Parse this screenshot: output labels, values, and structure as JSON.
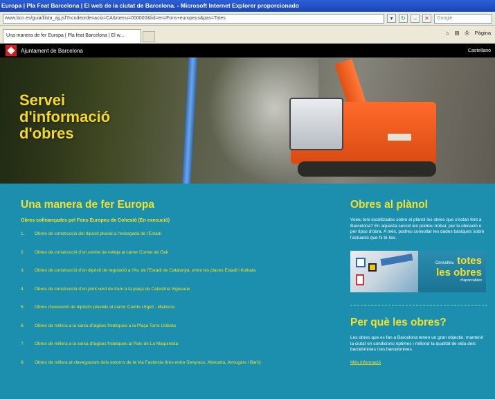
{
  "browser": {
    "title": "Europa | Pla Feat Barcelona | El web de la ciutat de Barcelona. - Microsoft Internet Explorer proporcionado",
    "address": "www.bcn.es/guia/llista_ajj.jsf?ncodeordenacio=CA&menu=000000&lid=en=Fons+europeus&pas=Totes",
    "search_placeholder": "Google",
    "tab_label": "Una manera de fer Europa | Pla feat Barcelona | El w...",
    "tools_page": "Pàgina"
  },
  "site": {
    "name": "Ajuntament de Barcelona",
    "language": "Castellano"
  },
  "hero": {
    "title_line1": "Servei",
    "title_line2": "d'informació",
    "title_line3": "d'obres"
  },
  "main": {
    "heading": "Una manera de fer Europa",
    "subtitle": "Obres cofinançades pel Fons Europeu de Cohesió (En execució)",
    "items": [
      {
        "num": "1.",
        "text": "Obres de construcció del dipòsit pluvial a l'esbogada de l'Estadi"
      },
      {
        "num": "2.",
        "text": "Obres de construcció d'un centre de neteja al carrer Comte de Gell"
      },
      {
        "num": "3.",
        "text": "Obres de construcció d'un dipòsit de regulació a l'Av. de l'Estadi de Catalunya, entre les places Estadi i Kolkata"
      },
      {
        "num": "4.",
        "text": "Obres de construcció d'un pont verd de tram a la plaça de Celestina Vigneaux"
      },
      {
        "num": "5.",
        "text": "Obres d'execució de dipòsits pluvials al carrer Comte Urgell - Mallorca"
      },
      {
        "num": "6.",
        "text": "Obres de millora a la xarxa d'aigües freàtiques a la Plaça Torre Llobeta"
      },
      {
        "num": "7.",
        "text": "Obres de millora a la xarxa d'aigües freàtiques al Parc de La Maquinista"
      },
      {
        "num": "8.",
        "text": "Obres de millora al clavegueram dels entorns de la Via Favència (tres entre Senyracs, Altecarta, Almugàrs i Barri)"
      }
    ]
  },
  "side": {
    "map_heading": "Obres al plànol",
    "map_text": "Veieu teni localitzades sobre el plànol les obres que s'estan fent a Barcelona? En aquesta secció les podreu trobar, per la ubicació o per tipus d'obra. A més, podreu consultar les dades bàsiques sobre l'actuació que hi té lloc.",
    "banner_small": "Consulteu",
    "banner_big1": "totes",
    "banner_big2": "les obres",
    "banner_tiny": "d'aparcables",
    "why_heading": "Per què les obres?",
    "why_text": "Les obres que es fan a Barcelona tenen un gran objectiu: mantenir la ciutat en condicions òptimes i millorar la qualitat de vida dels barcelonines i les barcelonines.",
    "more_link": "Més informació"
  },
  "colors": {
    "content_bg": "#1d8fae",
    "accent_yellow": "#f4e12a",
    "site_header": "#000000",
    "logo_red": "#d71920"
  }
}
